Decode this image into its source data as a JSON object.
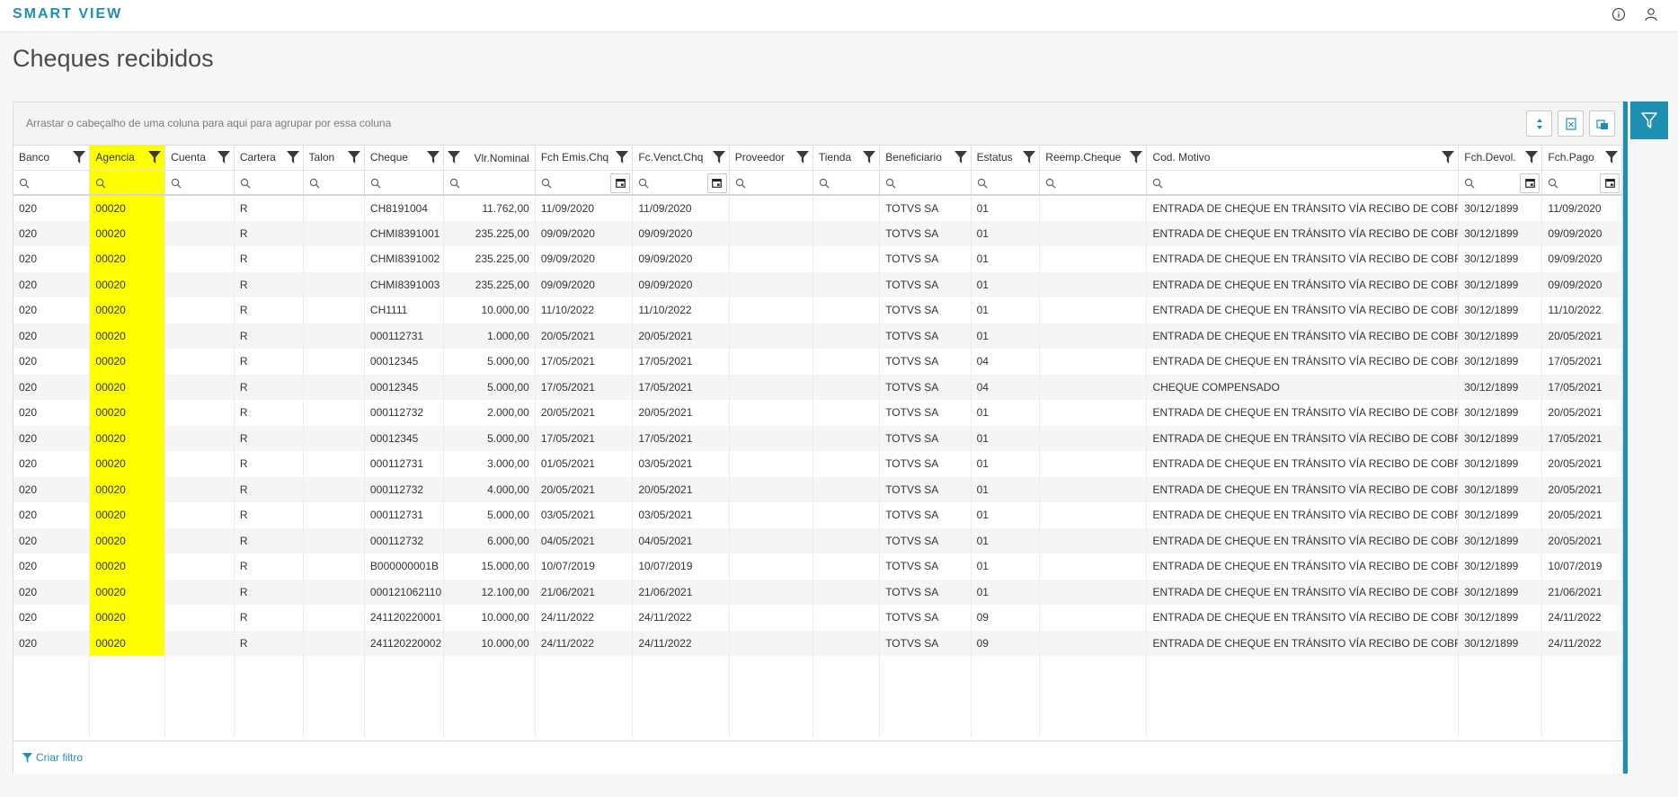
{
  "app": {
    "brand": "SMART VIEW",
    "title": "Cheques recibidos"
  },
  "group_bar": {
    "text": "Arrastar o cabeçalho de uma coluna para aqui para agrupar por essa coluna"
  },
  "footer": {
    "criar_filtro": "Criar filtro"
  },
  "colors": {
    "accent": "#1d8fb3",
    "highlight": "#ffff00"
  },
  "columns": [
    {
      "label": "Banco"
    },
    {
      "label": "Agencia"
    },
    {
      "label": "Cuenta"
    },
    {
      "label": "Cartera"
    },
    {
      "label": "Talon"
    },
    {
      "label": "Cheque"
    },
    {
      "label": "Vlr.Nominal"
    },
    {
      "label": "Fch Emis.Chq"
    },
    {
      "label": "Fc.Venct.Chq"
    },
    {
      "label": "Proveedor"
    },
    {
      "label": "Tienda"
    },
    {
      "label": "Beneficiario"
    },
    {
      "label": "Estatus"
    },
    {
      "label": "Reemp.Cheque"
    },
    {
      "label": "Cod. Motivo"
    },
    {
      "label": "Fch.Devol."
    },
    {
      "label": "Fch.Pago"
    }
  ],
  "rows": [
    [
      "020",
      "00020",
      "",
      "R",
      "",
      "CH8191004",
      "11.762,00",
      "11/09/2020",
      "11/09/2020",
      "",
      "",
      "TOTVS SA",
      "01",
      "",
      "ENTRADA DE CHEQUE EN TRÁNSITO VÍA RECIBO DE COBRANZA",
      "30/12/1899",
      "11/09/2020"
    ],
    [
      "020",
      "00020",
      "",
      "R",
      "",
      "CHMI8391001",
      "235.225,00",
      "09/09/2020",
      "09/09/2020",
      "",
      "",
      "TOTVS SA",
      "01",
      "",
      "ENTRADA DE CHEQUE EN TRÁNSITO VÍA RECIBO DE COBRANZA",
      "30/12/1899",
      "09/09/2020"
    ],
    [
      "020",
      "00020",
      "",
      "R",
      "",
      "CHMI8391002",
      "235.225,00",
      "09/09/2020",
      "09/09/2020",
      "",
      "",
      "TOTVS SA",
      "01",
      "",
      "ENTRADA DE CHEQUE EN TRÁNSITO VÍA RECIBO DE COBRANZA",
      "30/12/1899",
      "09/09/2020"
    ],
    [
      "020",
      "00020",
      "",
      "R",
      "",
      "CHMI8391003",
      "235.225,00",
      "09/09/2020",
      "09/09/2020",
      "",
      "",
      "TOTVS SA",
      "01",
      "",
      "ENTRADA DE CHEQUE EN TRÁNSITO VÍA RECIBO DE COBRANZA",
      "30/12/1899",
      "09/09/2020"
    ],
    [
      "020",
      "00020",
      "",
      "R",
      "",
      "CH1111",
      "10.000,00",
      "11/10/2022",
      "11/10/2022",
      "",
      "",
      "TOTVS SA",
      "01",
      "",
      "ENTRADA DE CHEQUE EN TRÁNSITO VÍA RECIBO DE COBRANZA",
      "30/12/1899",
      "11/10/2022"
    ],
    [
      "020",
      "00020",
      "",
      "R",
      "",
      "000112731",
      "1.000,00",
      "20/05/2021",
      "20/05/2021",
      "",
      "",
      "TOTVS SA",
      "01",
      "",
      "ENTRADA DE CHEQUE EN TRÁNSITO VÍA RECIBO DE COBRANZA",
      "30/12/1899",
      "20/05/2021"
    ],
    [
      "020",
      "00020",
      "",
      "R",
      "",
      "00012345",
      "5.000,00",
      "17/05/2021",
      "17/05/2021",
      "",
      "",
      "TOTVS SA",
      "04",
      "",
      "ENTRADA DE CHEQUE EN TRÁNSITO VÍA RECIBO DE COBRANZA",
      "30/12/1899",
      "17/05/2021"
    ],
    [
      "020",
      "00020",
      "",
      "R",
      "",
      "00012345",
      "5.000,00",
      "17/05/2021",
      "17/05/2021",
      "",
      "",
      "TOTVS SA",
      "04",
      "",
      "CHEQUE COMPENSADO",
      "30/12/1899",
      "17/05/2021"
    ],
    [
      "020",
      "00020",
      "",
      "R",
      "",
      "000112732",
      "2.000,00",
      "20/05/2021",
      "20/05/2021",
      "",
      "",
      "TOTVS SA",
      "01",
      "",
      "ENTRADA DE CHEQUE EN TRÁNSITO VÍA RECIBO DE COBRANZA",
      "30/12/1899",
      "20/05/2021"
    ],
    [
      "020",
      "00020",
      "",
      "R",
      "",
      "00012345",
      "5.000,00",
      "17/05/2021",
      "17/05/2021",
      "",
      "",
      "TOTVS SA",
      "01",
      "",
      "ENTRADA DE CHEQUE EN TRÁNSITO VÍA RECIBO DE COBRANZA",
      "30/12/1899",
      "17/05/2021"
    ],
    [
      "020",
      "00020",
      "",
      "R",
      "",
      "000112731",
      "3.000,00",
      "01/05/2021",
      "03/05/2021",
      "",
      "",
      "TOTVS SA",
      "01",
      "",
      "ENTRADA DE CHEQUE EN TRÁNSITO VÍA RECIBO DE COBRANZA",
      "30/12/1899",
      "20/05/2021"
    ],
    [
      "020",
      "00020",
      "",
      "R",
      "",
      "000112732",
      "4.000,00",
      "20/05/2021",
      "20/05/2021",
      "",
      "",
      "TOTVS SA",
      "01",
      "",
      "ENTRADA DE CHEQUE EN TRÁNSITO VÍA RECIBO DE COBRANZA",
      "30/12/1899",
      "20/05/2021"
    ],
    [
      "020",
      "00020",
      "",
      "R",
      "",
      "000112731",
      "5.000,00",
      "03/05/2021",
      "03/05/2021",
      "",
      "",
      "TOTVS SA",
      "01",
      "",
      "ENTRADA DE CHEQUE EN TRÁNSITO VÍA RECIBO DE COBRANZA",
      "30/12/1899",
      "20/05/2021"
    ],
    [
      "020",
      "00020",
      "",
      "R",
      "",
      "000112732",
      "6.000,00",
      "04/05/2021",
      "04/05/2021",
      "",
      "",
      "TOTVS SA",
      "01",
      "",
      "ENTRADA DE CHEQUE EN TRÁNSITO VÍA RECIBO DE COBRANZA",
      "30/12/1899",
      "20/05/2021"
    ],
    [
      "020",
      "00020",
      "",
      "R",
      "",
      "B000000001B",
      "15.000,00",
      "10/07/2019",
      "10/07/2019",
      "",
      "",
      "TOTVS SA",
      "01",
      "",
      "ENTRADA DE CHEQUE EN TRÁNSITO VÍA RECIBO DE COBRANZA",
      "30/12/1899",
      "10/07/2019"
    ],
    [
      "020",
      "00020",
      "",
      "R",
      "",
      "000121062110",
      "12.100,00",
      "21/06/2021",
      "21/06/2021",
      "",
      "",
      "TOTVS SA",
      "01",
      "",
      "ENTRADA DE CHEQUE EN TRÁNSITO VÍA RECIBO DE COBRANZA",
      "30/12/1899",
      "21/06/2021"
    ],
    [
      "020",
      "00020",
      "",
      "R",
      "",
      "241120220001",
      "10.000,00",
      "24/11/2022",
      "24/11/2022",
      "",
      "",
      "TOTVS SA",
      "09",
      "",
      "ENTRADA DE CHEQUE EN TRÁNSITO VÍA RECIBO DE COBRANZA",
      "30/12/1899",
      "24/11/2022"
    ],
    [
      "020",
      "00020",
      "",
      "R",
      "",
      "241120220002",
      "10.000,00",
      "24/11/2022",
      "24/11/2022",
      "",
      "",
      "TOTVS SA",
      "09",
      "",
      "ENTRADA DE CHEQUE EN TRÁNSITO VÍA RECIBO DE COBRANZA",
      "30/12/1899",
      "24/11/2022"
    ]
  ]
}
